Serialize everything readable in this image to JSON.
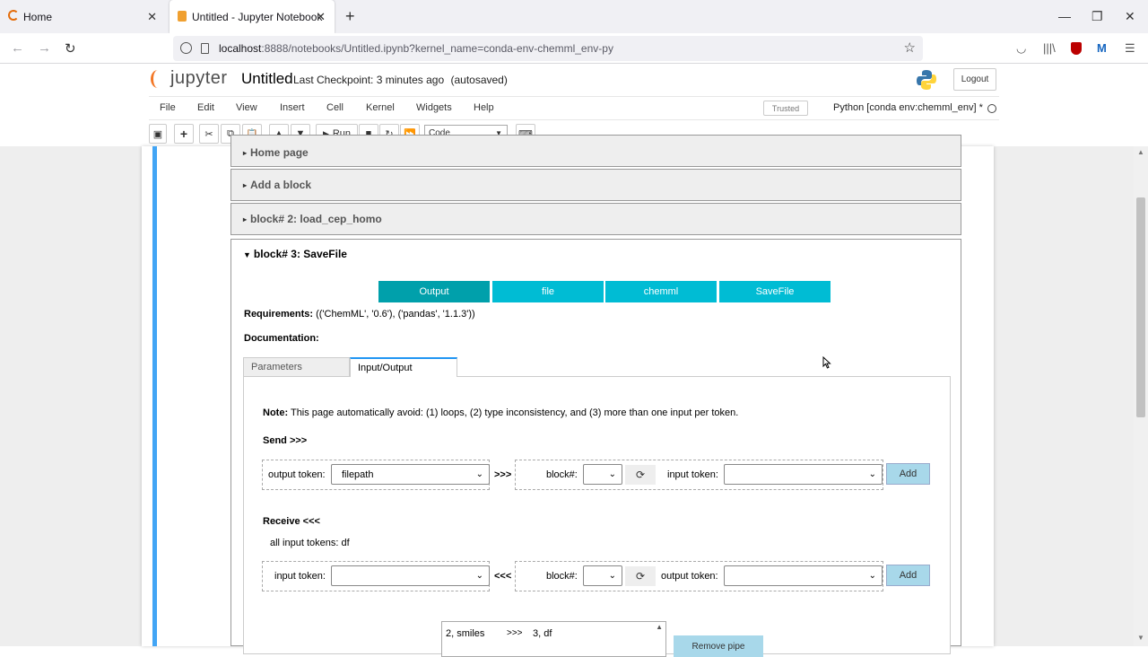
{
  "browser": {
    "tabs": [
      {
        "title": "Home",
        "active": false
      },
      {
        "title": "Untitled - Jupyter Notebook",
        "active": true
      }
    ],
    "url_host": "localhost",
    "url_rest": ":8888/notebooks/Untitled.ipynb?kernel_name=conda-env-chemml_env-py"
  },
  "jupyter": {
    "logo_text": "jupyter",
    "notebook_title": "Untitled",
    "checkpoint_label": "Last Checkpoint:",
    "checkpoint_time": "3 minutes ago",
    "autosave": "(autosaved)",
    "logout_label": "Logout",
    "menu": [
      "File",
      "Edit",
      "View",
      "Insert",
      "Cell",
      "Kernel",
      "Widgets",
      "Help"
    ],
    "trusted_label": "Trusted",
    "kernel_name": "Python [conda env:chemml_env] *",
    "run_label": "Run",
    "cell_type": "Code"
  },
  "accordion": {
    "home": "Home page",
    "add_block": "Add a block",
    "block2": "block# 2: load_cep_homo",
    "block3": "block# 3: SaveFile"
  },
  "block3": {
    "pills": [
      "Output",
      "file",
      "chemml",
      "SaveFile"
    ],
    "requirements_label": "Requirements:",
    "requirements_value": "(('ChemML', '0.6'), ('pandas', '1.1.3'))",
    "documentation_label": "Documentation:",
    "tabs": [
      "Parameters",
      "Input/Output"
    ],
    "note_label": "Note:",
    "note_text": "This page automatically avoid: (1) loops, (2) type inconsistency, and (3) more than one input per token.",
    "send_label": "Send >>>",
    "send": {
      "output_token_label": "output token:",
      "output_token_value": "filepath",
      "arrow": ">>>",
      "block_label": "block#:",
      "input_token_label": "input token:",
      "add_label": "Add"
    },
    "receive_label": "Receive <<<",
    "all_input_tokens": "all input tokens: df",
    "receive": {
      "input_token_label": "input token:",
      "arrow": "<<<",
      "block_label": "block#:",
      "output_token_label": "output token:",
      "add_label": "Add"
    },
    "pipe": {
      "from": "2, smiles",
      "arrow": ">>>",
      "to": "3, df"
    },
    "remove_pipe_label": "Remove pipe"
  },
  "colors": {
    "pill_active": "#00a0ab",
    "pill": "#00bcd4",
    "cell_selected": "#42a5f5",
    "add_button": "#a8d8ea"
  }
}
